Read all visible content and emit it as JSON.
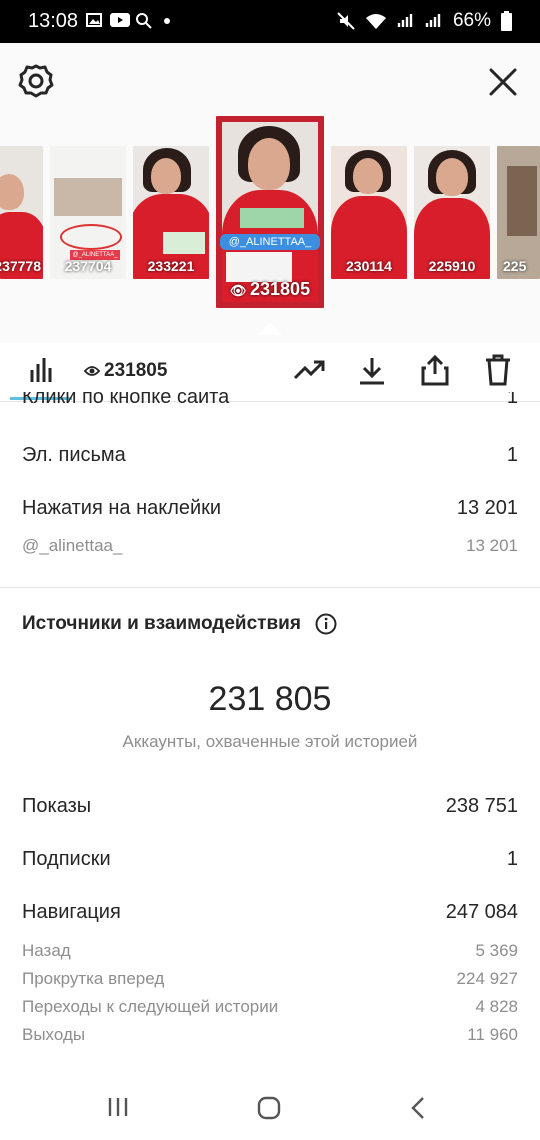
{
  "status_bar": {
    "time": "13:08",
    "battery": "66%"
  },
  "header": {
    "settings_icon": "gear-icon",
    "close_icon": "close-icon"
  },
  "stories": [
    {
      "count": "237778"
    },
    {
      "count": "237704",
      "caption": "@_ALINETTAA_"
    },
    {
      "count": "233221"
    },
    {
      "count": "231805",
      "mention": "@_ALINETTAA_",
      "selected": true
    },
    {
      "count": "230114"
    },
    {
      "count": "225910"
    },
    {
      "count": "225"
    }
  ],
  "toolbar": {
    "views": "231805",
    "icons": [
      "bar-chart-icon",
      "eye-icon",
      "trending-icon",
      "download-icon",
      "share-icon",
      "trash-icon"
    ]
  },
  "interactions": {
    "website_clicks": {
      "label": "Клики по кнопке сайта",
      "value": "1"
    },
    "emails": {
      "label": "Эл. письма",
      "value": "1"
    },
    "sticker_taps": {
      "label": "Нажатия на наклейки",
      "value": "13 201"
    },
    "sticker_mention": {
      "label": "@_alinettaa_",
      "value": "13 201"
    }
  },
  "discovery": {
    "title": "Источники и взаимодействия",
    "reach": "231 805",
    "reach_caption": "Аккаунты, охваченные этой историей",
    "impressions": {
      "label": "Показы",
      "value": "238 751"
    },
    "follows": {
      "label": "Подписки",
      "value": "1"
    },
    "navigation": {
      "label": "Навигация",
      "value": "247 084"
    },
    "nav_details": [
      {
        "label": "Назад",
        "value": "5 369"
      },
      {
        "label": "Прокрутка вперед",
        "value": "224 927"
      },
      {
        "label": "Переходы к следующей истории",
        "value": "4 828"
      },
      {
        "label": "Выходы",
        "value": "11 960"
      }
    ]
  }
}
